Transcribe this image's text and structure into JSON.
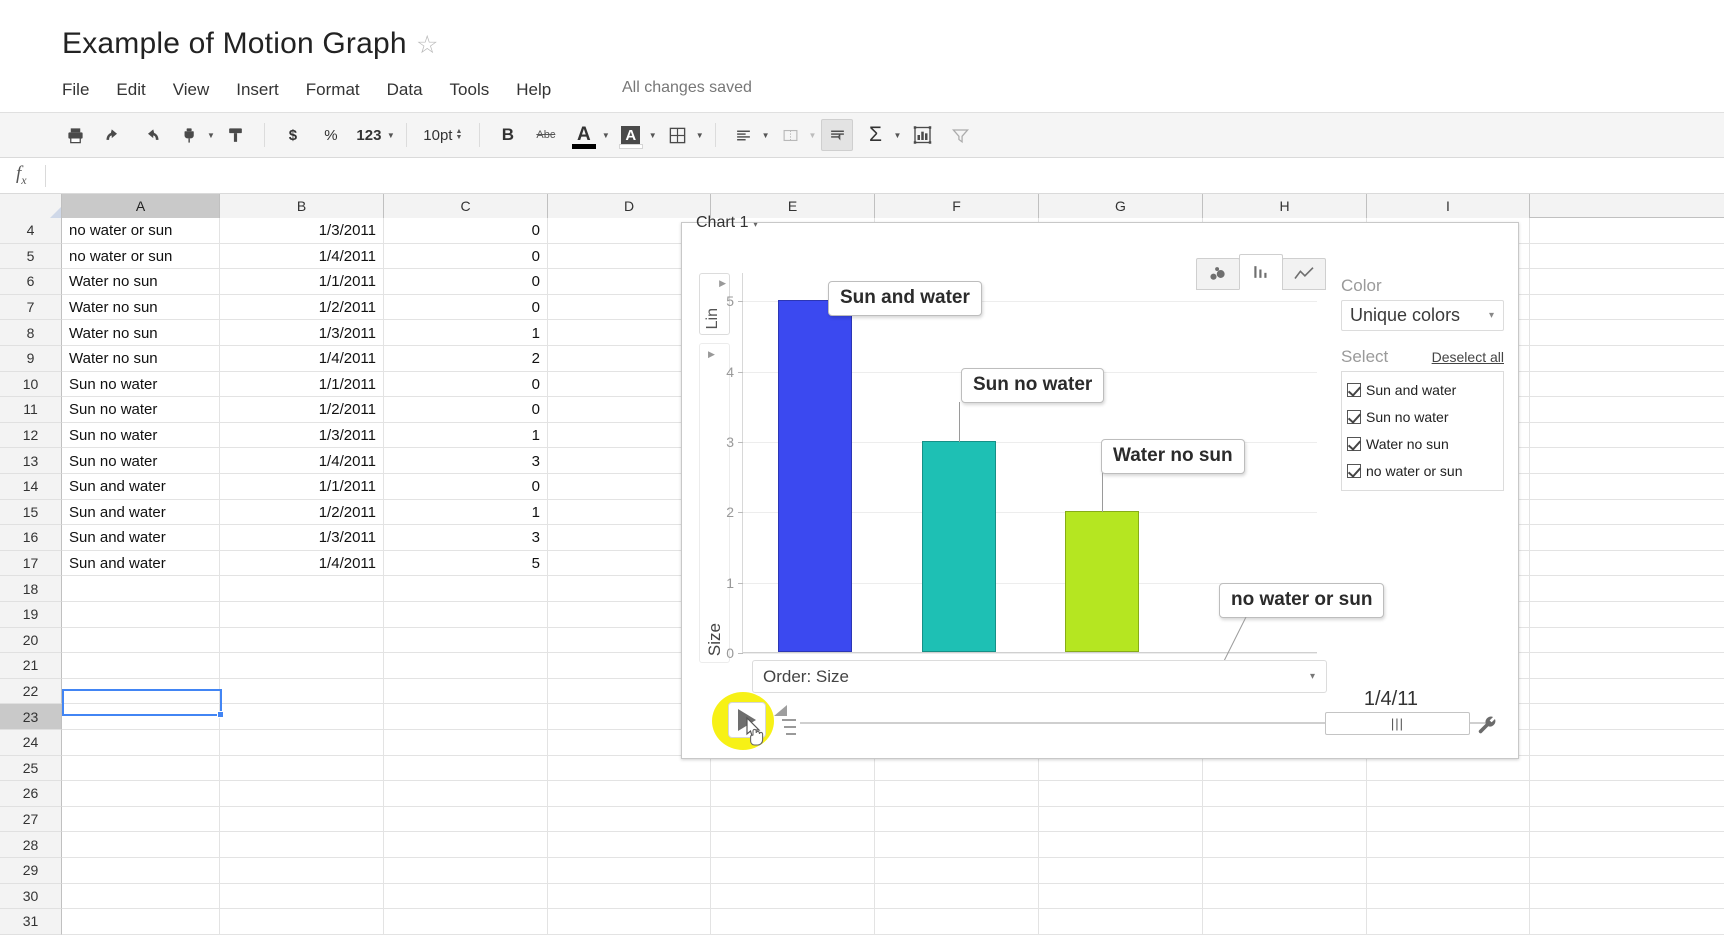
{
  "document": {
    "title": "Example of Motion Graph",
    "star_icon": "star-outline-icon",
    "save_status": "All changes saved"
  },
  "menubar": [
    "File",
    "Edit",
    "View",
    "Insert",
    "Format",
    "Data",
    "Tools",
    "Help"
  ],
  "toolbar": {
    "print": "print-icon",
    "undo": "undo-icon",
    "redo": "redo-icon",
    "paint_format": "paint-format-icon",
    "clear_format": "clear-format-icon",
    "currency": "$",
    "percent": "%",
    "number_format": "123",
    "font_size": "10pt",
    "bold": "B",
    "strikethrough": "Abc",
    "text_color": "A",
    "fill_color": "A",
    "borders": "borders-icon",
    "align": "align-icon",
    "merge": "merge-icon",
    "wrap": "wrap-text-icon",
    "functions": "Σ",
    "insert_chart": "insert-chart-icon",
    "filter": "filter-icon"
  },
  "formula_bar": {
    "fx": "fx",
    "value": ""
  },
  "sheet": {
    "columns": [
      "A",
      "B",
      "C",
      "D",
      "E",
      "F",
      "G",
      "H",
      "I"
    ],
    "selected_column": "A",
    "selected_row": "23",
    "active_cell": "A23",
    "rows": [
      {
        "n": "4",
        "a": "no water or sun",
        "b": "1/3/2011",
        "c": "0"
      },
      {
        "n": "5",
        "a": "no water or sun",
        "b": "1/4/2011",
        "c": "0"
      },
      {
        "n": "6",
        "a": "Water no sun",
        "b": "1/1/2011",
        "c": "0"
      },
      {
        "n": "7",
        "a": "Water no sun",
        "b": "1/2/2011",
        "c": "0"
      },
      {
        "n": "8",
        "a": "Water no sun",
        "b": "1/3/2011",
        "c": "1"
      },
      {
        "n": "9",
        "a": "Water no sun",
        "b": "1/4/2011",
        "c": "2"
      },
      {
        "n": "10",
        "a": "Sun no water",
        "b": "1/1/2011",
        "c": "0"
      },
      {
        "n": "11",
        "a": "Sun no water",
        "b": "1/2/2011",
        "c": "0"
      },
      {
        "n": "12",
        "a": "Sun no water",
        "b": "1/3/2011",
        "c": "1"
      },
      {
        "n": "13",
        "a": "Sun no water",
        "b": "1/4/2011",
        "c": "3"
      },
      {
        "n": "14",
        "a": "Sun and water",
        "b": "1/1/2011",
        "c": "0"
      },
      {
        "n": "15",
        "a": "Sun and water",
        "b": "1/2/2011",
        "c": "1"
      },
      {
        "n": "16",
        "a": "Sun and water",
        "b": "1/3/2011",
        "c": "3"
      },
      {
        "n": "17",
        "a": "Sun and water",
        "b": "1/4/2011",
        "c": "5"
      },
      {
        "n": "18",
        "a": "",
        "b": "",
        "c": ""
      },
      {
        "n": "19",
        "a": "",
        "b": "",
        "c": ""
      },
      {
        "n": "20",
        "a": "",
        "b": "",
        "c": ""
      },
      {
        "n": "21",
        "a": "",
        "b": "",
        "c": ""
      },
      {
        "n": "22",
        "a": "",
        "b": "",
        "c": ""
      },
      {
        "n": "23",
        "a": "",
        "b": "",
        "c": ""
      },
      {
        "n": "24",
        "a": "",
        "b": "",
        "c": ""
      },
      {
        "n": "25",
        "a": "",
        "b": "",
        "c": ""
      },
      {
        "n": "26",
        "a": "",
        "b": "",
        "c": ""
      },
      {
        "n": "27",
        "a": "",
        "b": "",
        "c": ""
      },
      {
        "n": "28",
        "a": "",
        "b": "",
        "c": ""
      },
      {
        "n": "29",
        "a": "",
        "b": "",
        "c": ""
      },
      {
        "n": "30",
        "a": "",
        "b": "",
        "c": ""
      },
      {
        "n": "31",
        "a": "",
        "b": "",
        "c": ""
      }
    ]
  },
  "chart_panel": {
    "caption": "Chart 1",
    "caption_arrow": "▾",
    "type_tabs": [
      {
        "name": "bubble-chart-tab",
        "icon": "bubble-icon",
        "selected": false
      },
      {
        "name": "bar-chart-tab",
        "icon": "bar-icon",
        "selected": true
      },
      {
        "name": "line-chart-tab",
        "icon": "line-icon",
        "selected": false
      }
    ],
    "y_scale_button": "Lin",
    "y_axis_label": "Size",
    "order_select": "Order: Size",
    "order_caret": "▾",
    "side_panel": {
      "color_label": "Color",
      "color_value": "Unique colors",
      "color_caret": "▾",
      "select_label": "Select",
      "deselect_all": "Deselect all",
      "items": [
        {
          "label": "Sun and water",
          "checked": true
        },
        {
          "label": "Sun no water",
          "checked": true
        },
        {
          "label": "Water no sun",
          "checked": true
        },
        {
          "label": "no water or sun",
          "checked": true
        }
      ]
    },
    "playback": {
      "play_button": "play-icon",
      "speed_control": "speed-icon",
      "current_date": "1/4/11",
      "slider_thumb": "|||",
      "settings": "wrench-icon",
      "highlighted": true
    }
  },
  "chart_data": {
    "type": "bar",
    "title": "Chart 1",
    "categories": [
      "Sun and water",
      "Sun no water",
      "Water no sun",
      "no water or sun"
    ],
    "values": [
      5,
      3,
      2,
      0
    ],
    "colors": [
      "#3b49f0",
      "#1ec0b4",
      "#b5e621",
      "#ff9900"
    ],
    "xlabel": "",
    "ylabel": "Size",
    "ylim": [
      0,
      5.4
    ],
    "yticks": [
      0,
      1,
      2,
      3,
      4,
      5
    ],
    "grid": true,
    "legend_position": "right",
    "annotations": [
      "Sun and water",
      "Sun no water",
      "Water no sun",
      "no water or sun"
    ],
    "time_frame": "1/4/11",
    "scale": "Lin",
    "order": "Order: Size"
  }
}
